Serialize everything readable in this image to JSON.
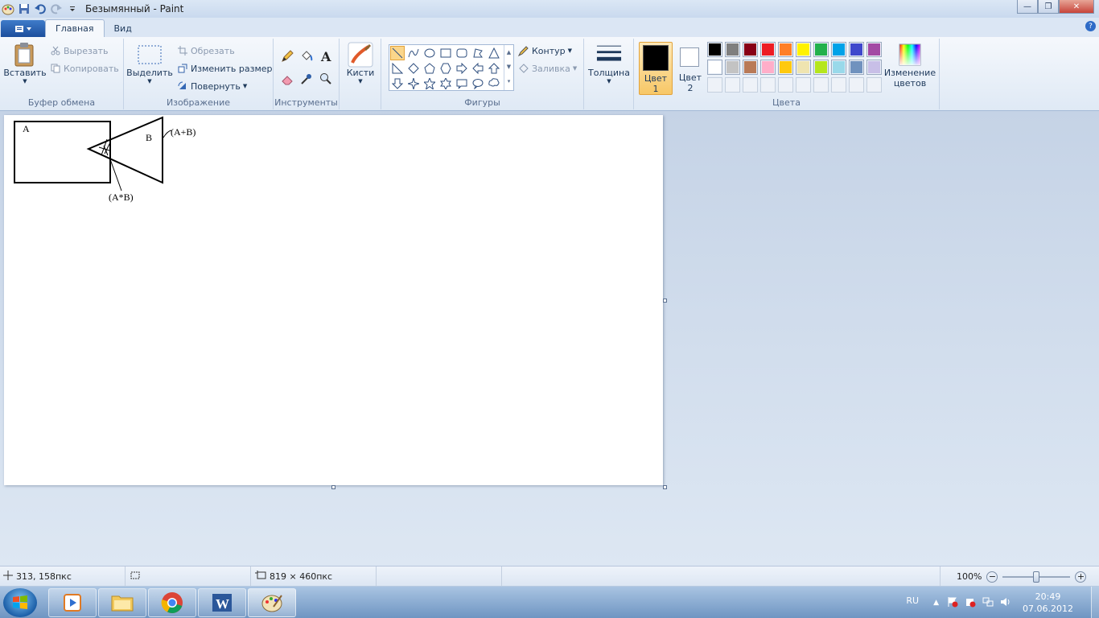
{
  "window": {
    "title": "Безымянный - Paint"
  },
  "tabs": [
    {
      "label": "Главная"
    },
    {
      "label": "Вид"
    }
  ],
  "clipboard": {
    "paste": "Вставить",
    "cut": "Вырезать",
    "copy": "Копировать",
    "group": "Буфер обмена"
  },
  "image": {
    "select": "Выделить",
    "crop": "Обрезать",
    "resize": "Изменить размер",
    "rotate": "Повернуть",
    "group": "Изображение"
  },
  "tools": {
    "group": "Инструменты"
  },
  "brushes": {
    "label": "Кисти"
  },
  "shapes": {
    "group": "Фигуры",
    "outline": "Контур",
    "fill": "Заливка"
  },
  "size": {
    "label": "Толщина"
  },
  "colors": {
    "color1": "Цвет 1",
    "color1_line1": "Цвет",
    "color1_line2": "1",
    "color2_line1": "Цвет",
    "color2_line2": "2",
    "edit_line1": "Изменение",
    "edit_line2": "цветов",
    "group": "Цвета",
    "palette_row1": [
      "#000000",
      "#7f7f7f",
      "#880015",
      "#ed1c24",
      "#ff7f27",
      "#fff200",
      "#22b14c",
      "#00a2e8",
      "#3f48cc",
      "#a349a4"
    ],
    "palette_row2": [
      "#ffffff",
      "#c3c3c3",
      "#b97a57",
      "#ffaec9",
      "#ffc90e",
      "#efe4b0",
      "#b5e61d",
      "#99d9ea",
      "#7092be",
      "#c8bfe7"
    ]
  },
  "drawing": {
    "labelA": "A",
    "labelB": "B",
    "labelSum": "(A+B)",
    "labelProduct": "(A*B)"
  },
  "status": {
    "cursor": "313, 158пкс",
    "canvas_size": "819 × 460пкс",
    "zoom": "100%"
  },
  "taskbar": {
    "lang": "RU",
    "time": "20:49",
    "date": "07.06.2012"
  }
}
